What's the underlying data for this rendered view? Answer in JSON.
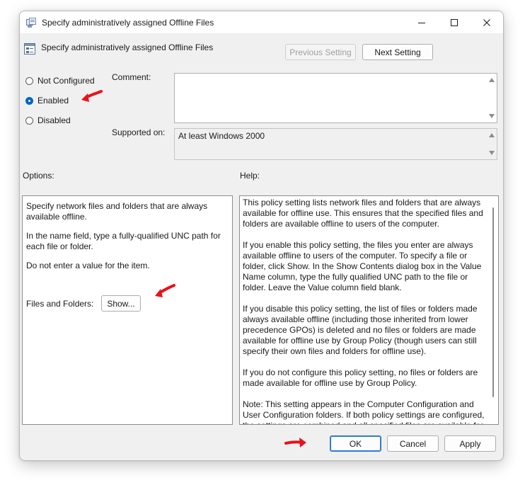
{
  "window": {
    "title": "Specify administratively assigned Offline Files",
    "setting_name": "Specify administratively assigned Offline Files"
  },
  "nav": {
    "previous_label": "Previous Setting",
    "next_label": "Next Setting"
  },
  "state": {
    "options": [
      {
        "label": "Not Configured",
        "checked": false
      },
      {
        "label": "Enabled",
        "checked": true
      },
      {
        "label": "Disabled",
        "checked": false
      }
    ]
  },
  "comment": {
    "label": "Comment:",
    "value": ""
  },
  "supported": {
    "label": "Supported on:",
    "value": "At least Windows 2000"
  },
  "options_section": {
    "label": "Options:",
    "paragraphs": [
      "Specify network files and folders that are always available offline.",
      "In the name field, type a fully-qualified UNC path for each file or folder.",
      "Do not enter a value for the item."
    ],
    "files_label": "Files and Folders:",
    "show_label": "Show..."
  },
  "help_section": {
    "label": "Help:",
    "paragraphs": [
      "This policy setting lists network files and folders that are always available for offline use. This ensures that the specified files and folders are available offline to users of the computer.",
      "If you enable this policy setting, the files you enter are always available offline to users of the computer. To specify a file or folder, click Show. In the Show Contents dialog box in the Value Name column, type the fully qualified UNC path to the file or folder. Leave the Value column field blank.",
      "If you disable this policy setting, the list of files or folders made always available offline (including those inherited from lower precedence GPOs) is deleted and no files or folders are made available for offline use by Group Policy (though users can still specify their own files and folders for offline use).",
      "If you do not configure this policy setting, no files or folders are made available for offline use by Group Policy.",
      "Note: This setting appears in the Computer Configuration and User Configuration folders. If both policy settings are configured, the settings are combined and all specified files are available for offline use."
    ]
  },
  "footer": {
    "ok_label": "OK",
    "cancel_label": "Cancel",
    "apply_label": "Apply"
  },
  "colors": {
    "accent": "#0067c0",
    "annotation_arrow": "#e8121a"
  }
}
